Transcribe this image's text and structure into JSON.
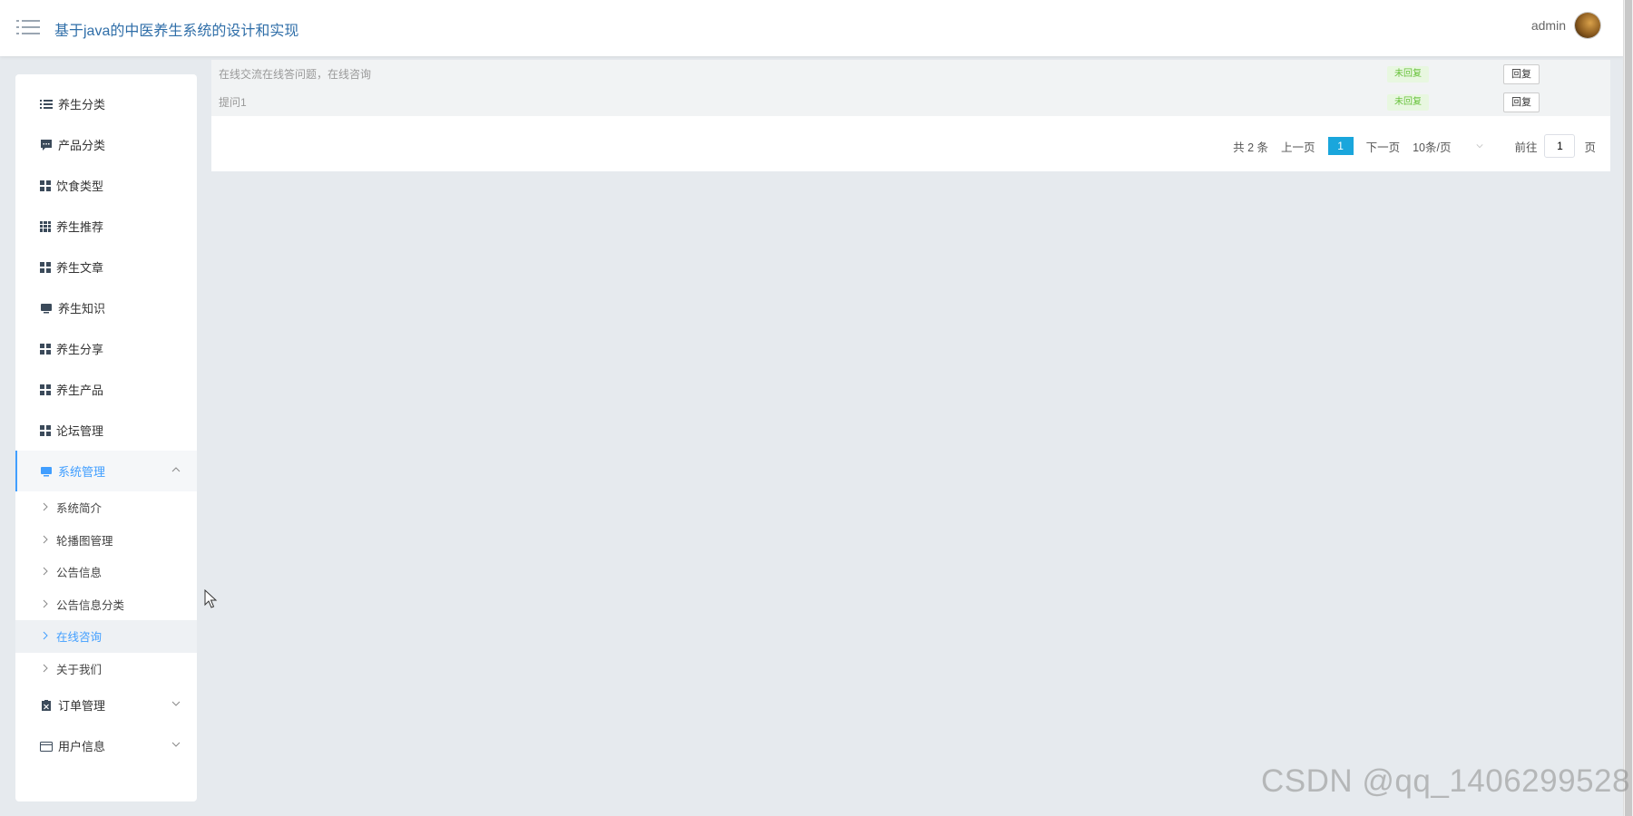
{
  "header": {
    "title": "基于java的中医养生系统的设计和实现",
    "username": "admin"
  },
  "sidebar": {
    "items": [
      {
        "label": "养生分类",
        "icon": "list-icon"
      },
      {
        "label": "产品分类",
        "icon": "comment-icon"
      },
      {
        "label": "饮食类型",
        "icon": "grid-icon"
      },
      {
        "label": "养生推荐",
        "icon": "grid9-icon"
      },
      {
        "label": "养生文章",
        "icon": "grid-icon"
      },
      {
        "label": "养生知识",
        "icon": "monitor-icon"
      },
      {
        "label": "养生分享",
        "icon": "grid-icon"
      },
      {
        "label": "养生产品",
        "icon": "grid-icon"
      },
      {
        "label": "论坛管理",
        "icon": "grid-icon"
      },
      {
        "label": "系统管理",
        "icon": "monitor-icon",
        "expanded": true
      }
    ],
    "system_submenu": [
      {
        "label": "系统简介"
      },
      {
        "label": "轮播图管理"
      },
      {
        "label": "公告信息"
      },
      {
        "label": "公告信息分类"
      },
      {
        "label": "在线咨询",
        "active": true
      },
      {
        "label": "关于我们"
      }
    ],
    "bottom_items": [
      {
        "label": "订单管理",
        "icon": "clipboard-icon"
      },
      {
        "label": "用户信息",
        "icon": "card-icon"
      }
    ]
  },
  "table": {
    "rows": [
      {
        "question": "在线交流在线答问题，在线咨询",
        "status": "未回复",
        "action": "回复"
      },
      {
        "question": "提问1",
        "status": "未回复",
        "action": "回复"
      }
    ]
  },
  "pagination": {
    "total": "共 2 条",
    "prev": "上一页",
    "current_page": "1",
    "next": "下一页",
    "page_size": "10条/页",
    "goto_label": "前往",
    "goto_value": "1",
    "page_suffix": "页"
  },
  "watermark": "CSDN @qq_1406299528",
  "colors": {
    "accent": "#409eff",
    "title": "#2f6ea8",
    "current_page": "#1aa6dc",
    "status_green": "#67c23a",
    "background": "#e6eaee"
  }
}
